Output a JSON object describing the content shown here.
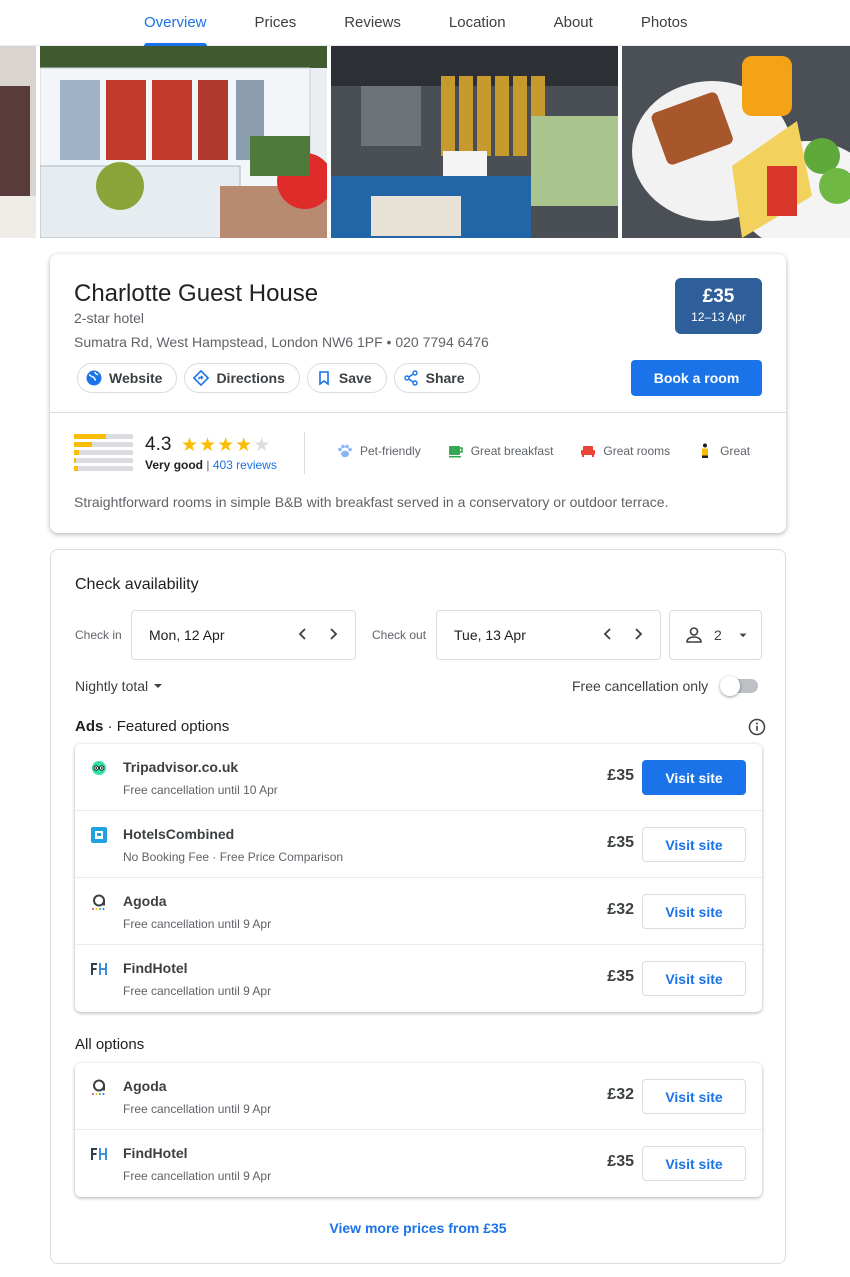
{
  "tabs": [
    "Overview",
    "Prices",
    "Reviews",
    "Location",
    "About",
    "Photos"
  ],
  "hotel": {
    "name": "Charlotte Guest House",
    "class": "2-star hotel",
    "address": "Sumatra Rd, West Hampstead, London NW6 1PF",
    "phone": "020 7794 6476",
    "price": "£35",
    "dates": "12–13 Apr",
    "actions": {
      "website": "Website",
      "directions": "Directions",
      "save": "Save",
      "share": "Share"
    },
    "book_label": "Book a room",
    "rating": "4.3",
    "rating_stars": 4.3,
    "rating_label": "Very good",
    "reviews": "403 reviews",
    "rating_distribution": [
      0.55,
      0.3,
      0.08,
      0.04,
      0.06
    ],
    "amenities": [
      "Pet-friendly",
      "Great breakfast",
      "Great rooms",
      "Great"
    ],
    "summary": "Straightforward rooms in simple B&B with breakfast served in a conservatory or outdoor terrace."
  },
  "availability": {
    "title": "Check availability",
    "checkin_label": "Check in",
    "checkin": "Mon, 12 Apr",
    "checkout_label": "Check out",
    "checkout": "Tue, 13 Apr",
    "guests": "2",
    "pricing_mode": "Nightly total",
    "free_cancel_label": "Free cancellation only",
    "featured_title_ads": "Ads",
    "featured_title": "Featured options",
    "all_title": "All options",
    "visit_label": "Visit site",
    "more_prices": "View more prices from £35",
    "featured": [
      {
        "name": "Tripadvisor.co.uk",
        "sub": "Free cancellation until 10 Apr",
        "price": "£35"
      },
      {
        "name": "HotelsCombined",
        "sub": "No Booking Fee · Free Price Comparison",
        "price": "£35"
      },
      {
        "name": "Agoda",
        "sub": "Free cancellation until 9 Apr",
        "price": "£32"
      },
      {
        "name": "FindHotel",
        "sub": "Free cancellation until 9 Apr",
        "price": "£35"
      }
    ],
    "all": [
      {
        "name": "Agoda",
        "sub": "Free cancellation until 9 Apr",
        "price": "£32"
      },
      {
        "name": "FindHotel",
        "sub": "Free cancellation until 9 Apr",
        "price": "£35"
      }
    ]
  },
  "colors": {
    "accent": "#1a73e8",
    "price_badge": "#2e5f9a",
    "star": "#fbbc04"
  }
}
